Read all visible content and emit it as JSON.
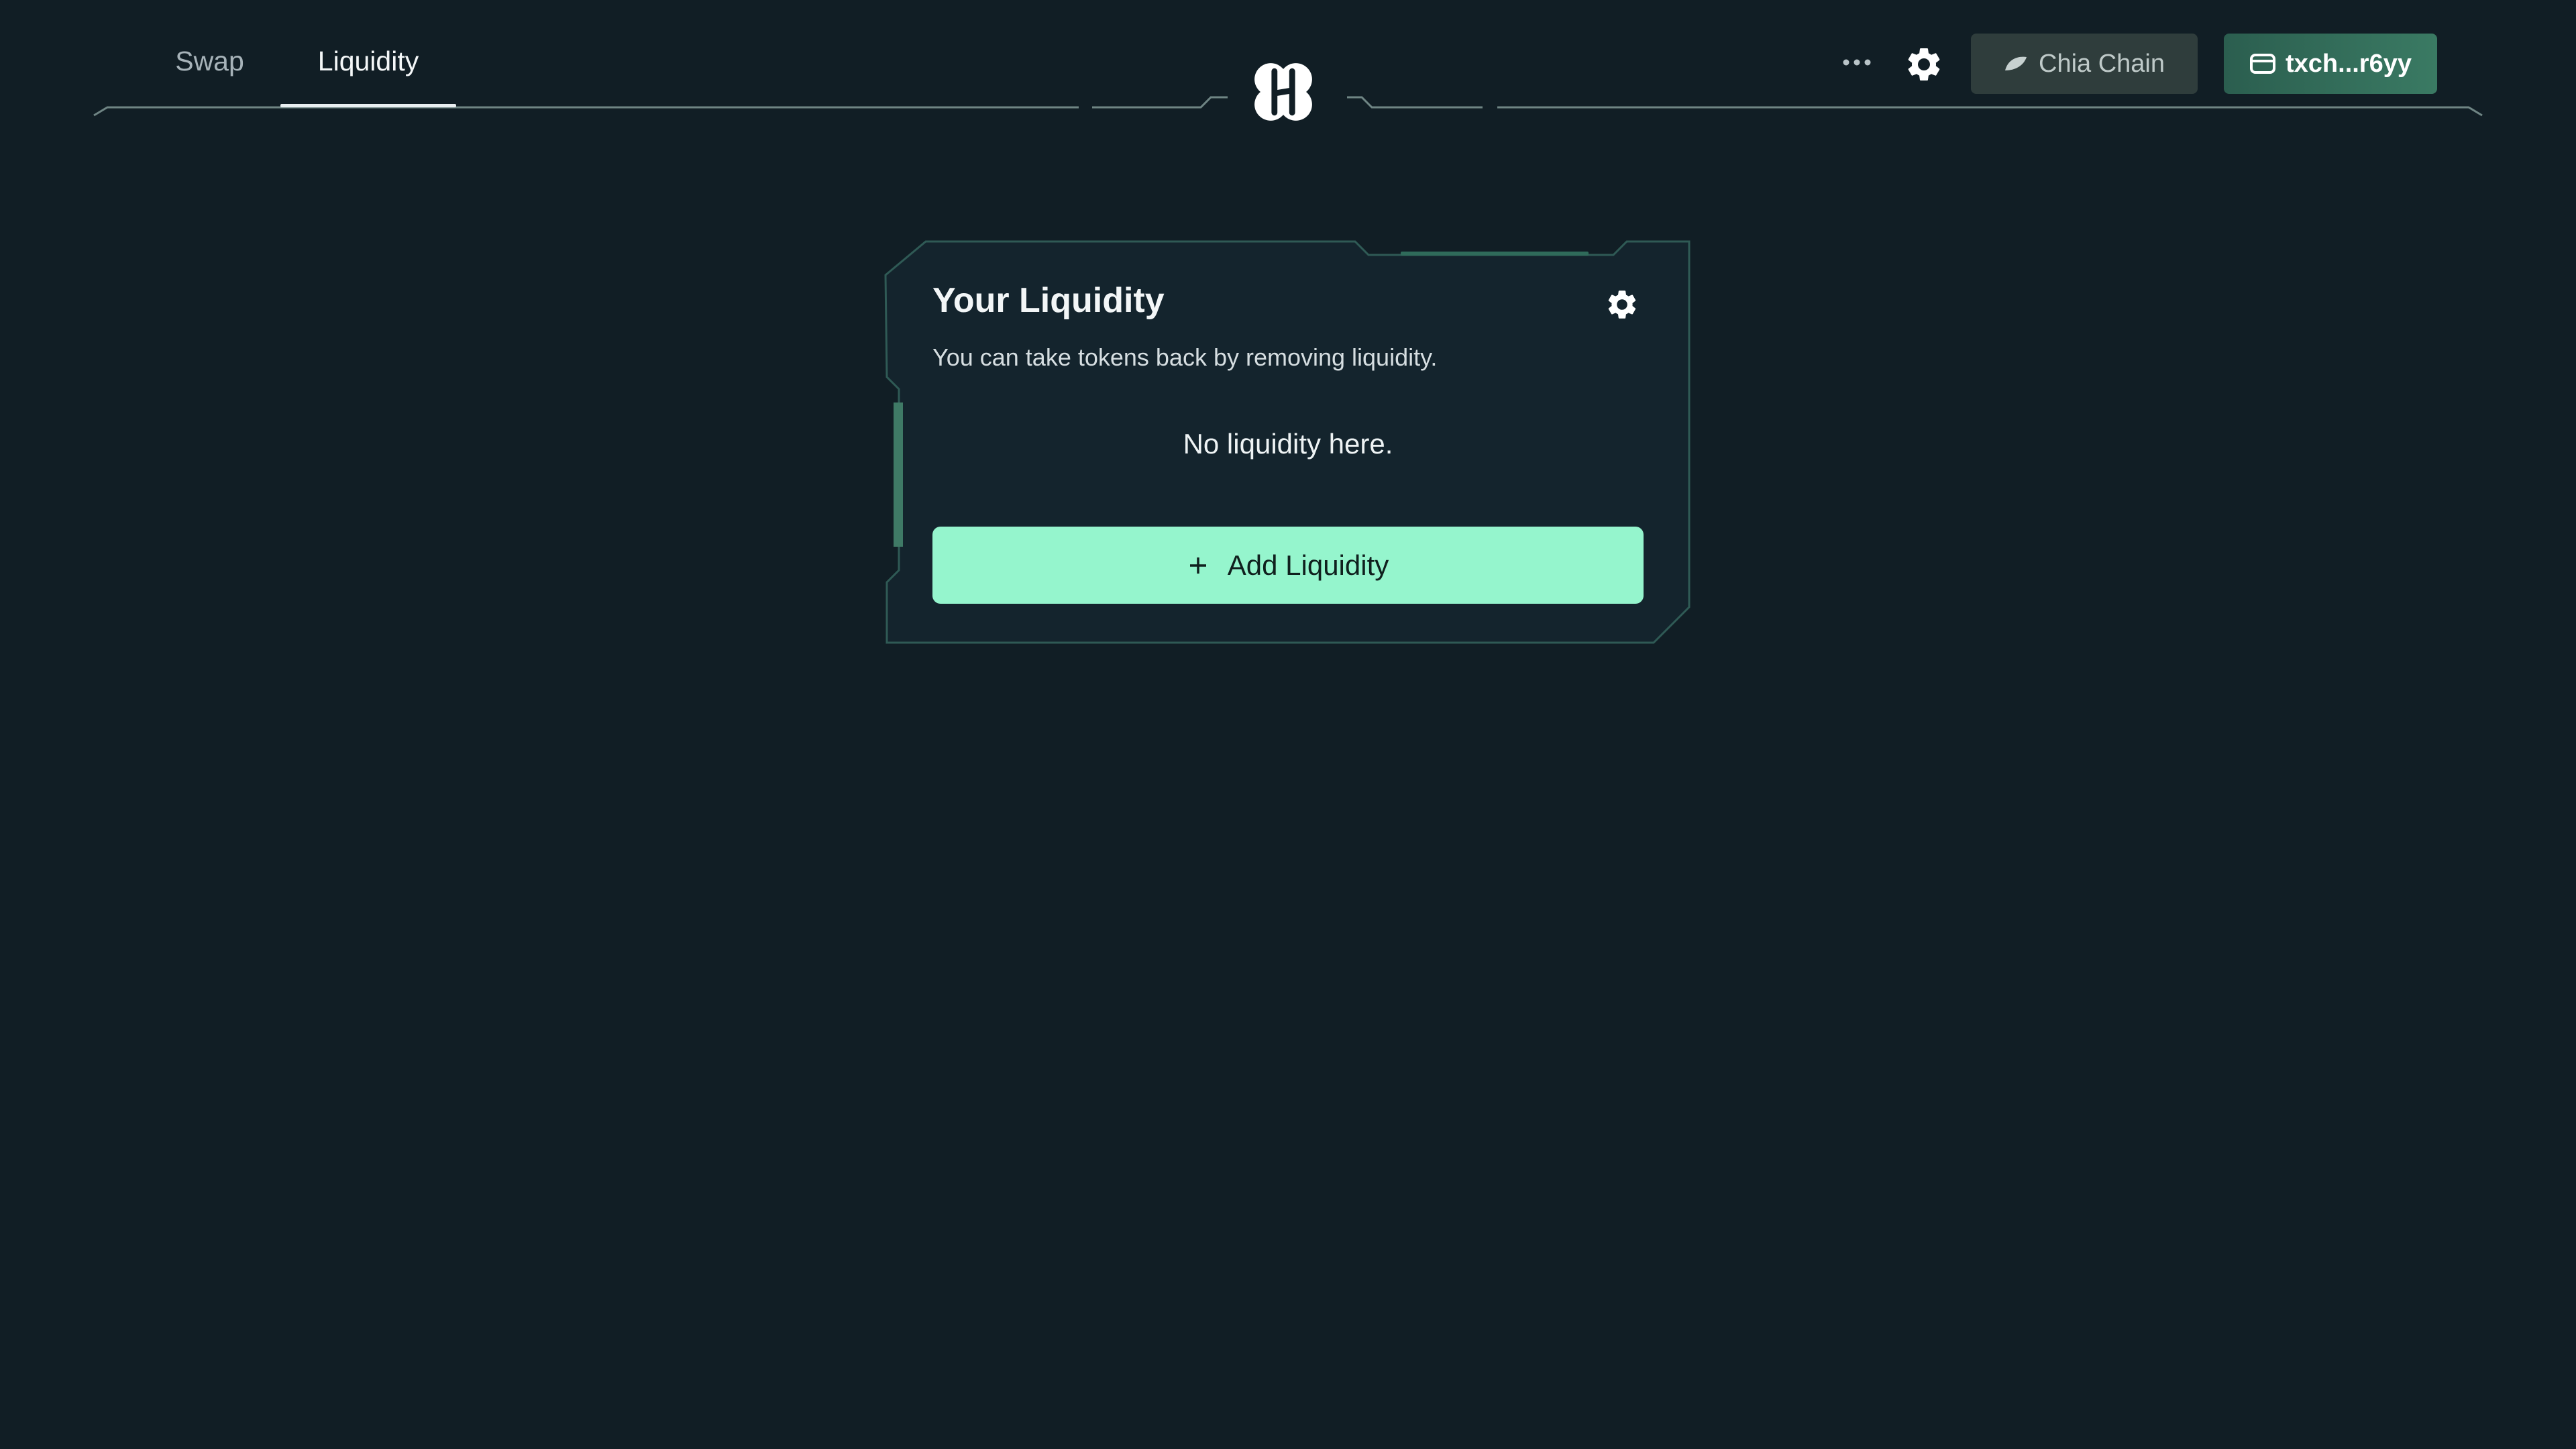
{
  "nav": {
    "tabs": [
      {
        "label": "Swap",
        "active": false
      },
      {
        "label": "Liquidity",
        "active": true
      }
    ]
  },
  "header": {
    "chain_label": "Chia Chain",
    "wallet_label": "txch...r6yy"
  },
  "card": {
    "title": "Your Liquidity",
    "subtitle": "You can take tokens back by removing liquidity.",
    "empty_message": "No liquidity here.",
    "add_button_label": "Add Liquidity"
  },
  "icons": {
    "more": "more-icon",
    "settings": "gear-icon",
    "chain": "leaf-icon",
    "wallet": "wallet-icon",
    "add": "plus-icon",
    "logo": "logo-icon"
  },
  "colors": {
    "background": "#111e25",
    "accent": "#95f5cd",
    "border": "#2f5a55"
  }
}
